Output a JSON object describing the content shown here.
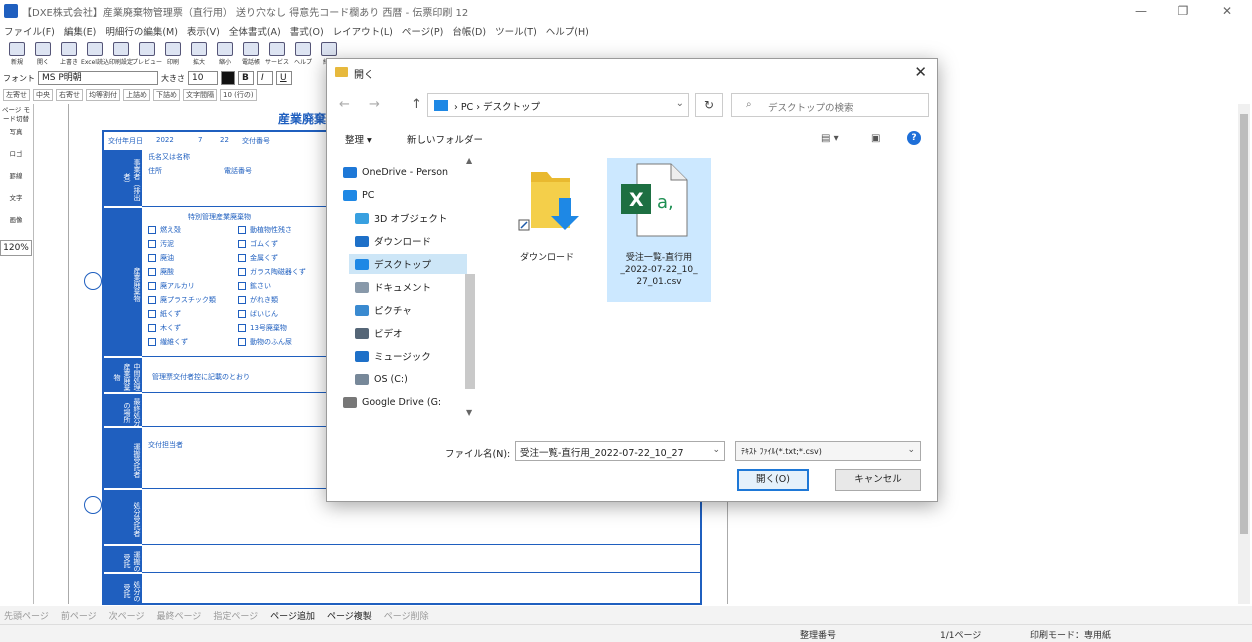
{
  "app": {
    "title": "【DXE株式会社】産業廃棄物管理票（直行用） 送り穴なし 得意先コード欄あり 西暦 - 伝票印刷 12",
    "window_buttons": [
      "—",
      "❐",
      "✕"
    ]
  },
  "menu": [
    "ファイル(F)",
    "編集(E)",
    "明細行の編集(M)",
    "表示(V)",
    "全体書式(A)",
    "書式(O)",
    "レイアウト(L)",
    "ページ(P)",
    "台帳(D)",
    "ツール(T)",
    "ヘルプ(H)"
  ],
  "toolbar": [
    {
      "label": "新規",
      "icon": "new-doc-icon"
    },
    {
      "label": "開く",
      "icon": "open-folder-icon"
    },
    {
      "label": "上書き",
      "icon": "save-icon"
    },
    {
      "label": "Excel読込",
      "icon": "excel-import-icon"
    },
    {
      "label": "印刷設定",
      "icon": "print-setup-icon"
    },
    {
      "label": "プレビュー",
      "icon": "preview-icon"
    },
    {
      "label": "印刷",
      "icon": "print-icon"
    },
    {
      "label": "拡大",
      "icon": "zoom-in-icon"
    },
    {
      "label": "縮小",
      "icon": "zoom-out-icon"
    },
    {
      "label": "電話帳",
      "icon": "phonebook-icon"
    },
    {
      "label": "サービス",
      "icon": "service-icon"
    },
    {
      "label": "ヘルプ",
      "icon": "help-icon"
    },
    {
      "label": "終了",
      "icon": "exit-icon"
    }
  ],
  "fontbar": {
    "label_font": "フォント",
    "font": "MS P明朝",
    "label_size": "大きさ",
    "size": "10",
    "bold": "B",
    "italic": "I",
    "underline": "U"
  },
  "fmtbar": [
    "左寄せ",
    "中央",
    "右寄せ",
    "均等割付",
    "上詰め",
    "下詰め",
    "文字間隔",
    "10 (行の)"
  ],
  "leftpanel": {
    "items": [
      "ページ モード切替",
      "写真",
      "ロゴ",
      "罫線",
      "文字",
      "画像"
    ],
    "zoom": "120%"
  },
  "form": {
    "title": "産業廃棄",
    "date_label": "交付年月日",
    "date_value": "2022",
    "month": "7",
    "day": "22",
    "receipt_label": "交付番号",
    "blocks": [
      "事業者（排出者）",
      "産業廃棄物",
      "中間処理産業廃棄物",
      "最終処分の場所",
      "運搬受託者",
      "処分受託者",
      "運搬の受託",
      "処分の受託"
    ],
    "items": [
      "燃え殻",
      "汚泥",
      "廃油",
      "廃酸",
      "廃アルカリ",
      "廃プラスチック類",
      "紙くず",
      "木くず",
      "繊維くず",
      "動植物性残さ",
      "ゴムくず",
      "金属くず",
      "ガラス陶磁器くず",
      "鉱さい",
      "がれき類",
      "ばいじん",
      "13号廃棄物",
      "動物のふん尿"
    ],
    "special_label": "特別管理産業廃棄物",
    "misc": [
      "住所",
      "電話番号",
      "氏名又は名称",
      "交付担当者",
      "管理票交付者控に記載のとおり"
    ]
  },
  "pagebar": [
    {
      "label": "先頭ページ",
      "on": false
    },
    {
      "label": "前ページ",
      "on": false
    },
    {
      "label": "次ページ",
      "on": false
    },
    {
      "label": "最終ページ",
      "on": false
    },
    {
      "label": "指定ページ",
      "on": false
    },
    {
      "label": "ページ追加",
      "on": true
    },
    {
      "label": "ページ複製",
      "on": true
    },
    {
      "label": "ページ削除",
      "on": false
    }
  ],
  "status": {
    "field": "整理番号",
    "page": "1/1ページ",
    "mode": "印刷モード：専用紙"
  },
  "dialog": {
    "title": "開く",
    "close": "✕",
    "nav": [
      "←",
      "→",
      "↑"
    ],
    "path": [
      "PC",
      "デスクトップ"
    ],
    "search_placeholder": "デスクトップの検索",
    "organize": "整理 ▾",
    "new_folder": "新しいフォルダー",
    "help": "?",
    "tree": [
      {
        "label": "OneDrive - Person",
        "icon": "cloud-icon",
        "color": "#1e78d7",
        "selected": false
      },
      {
        "label": "PC",
        "icon": "pc-icon",
        "color": "#1e88e5",
        "selected": false
      },
      {
        "label": "3D オブジェクト",
        "icon": "cube-icon",
        "color": "#38a0e0",
        "selected": false
      },
      {
        "label": "ダウンロード",
        "icon": "download-icon",
        "color": "#1e70c8",
        "selected": false
      },
      {
        "label": "デスクトップ",
        "icon": "desktop-icon",
        "color": "#1e88e5",
        "selected": true
      },
      {
        "label": "ドキュメント",
        "icon": "document-icon",
        "color": "#8899aa",
        "selected": false
      },
      {
        "label": "ピクチャ",
        "icon": "picture-icon",
        "color": "#3a8ad0",
        "selected": false
      },
      {
        "label": "ビデオ",
        "icon": "video-icon",
        "color": "#556677",
        "selected": false
      },
      {
        "label": "ミュージック",
        "icon": "music-icon",
        "color": "#1e70c8",
        "selected": false
      },
      {
        "label": "OS (C:)",
        "icon": "drive-icon",
        "color": "#778899",
        "selected": false
      },
      {
        "label": "Google Drive (G:",
        "icon": "google-drive-icon",
        "color": "#777777",
        "selected": false
      }
    ],
    "files": [
      {
        "name": "ダウンロード",
        "icon": "download-folder-icon",
        "selected": false
      },
      {
        "name": "受注一覧-直行用_2022-07-22_10_27_01.csv",
        "icon": "excel-csv-icon",
        "selected": true,
        "lines": [
          "受注一覧-直行用",
          "_2022-07-22_10_",
          "27_01.csv"
        ]
      }
    ],
    "filename_label": "ファイル名(N):",
    "filename_value": "受注一覧-直行用_2022-07-22_10_27",
    "filetype": "ﾃｷｽﾄ ﾌｧｲﾙ(*.txt;*.csv)",
    "open_button": "開く(O)",
    "cancel_button": "キャンセル"
  }
}
